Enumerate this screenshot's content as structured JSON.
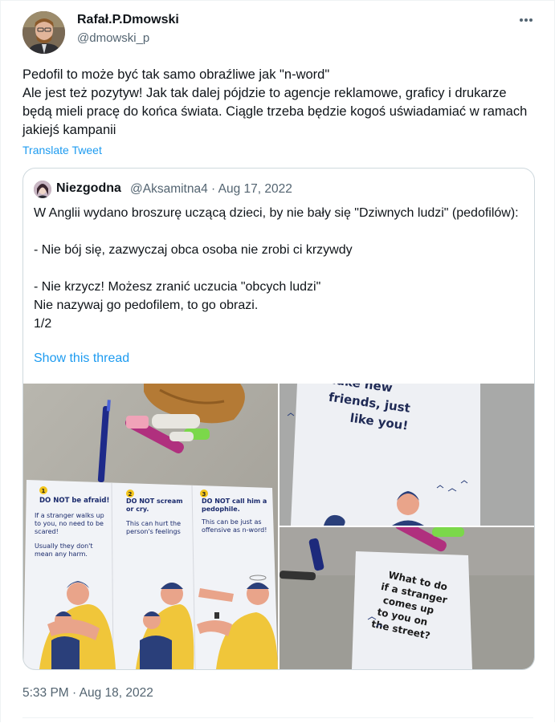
{
  "tweet": {
    "author_name": "Rafał.P.Dmowski",
    "author_handle": "@dmowski_p",
    "text": "Pedofil to może być tak samo obraźliwe jak \"n-word\"\nAle jest też pozytyw! Jak tak dalej pójdzie to agencje reklamowe, graficy i drukarze będą mieli pracę do końca świata. Ciągle trzeba będzie kogoś uświadamiać w ramach jakiejś kampanii",
    "translate_label": "Translate Tweet",
    "timestamp": "5:33 PM · Aug 18, 2022",
    "more_icon": "more-horizontal-icon"
  },
  "quote": {
    "author_name": "Niezgodna",
    "meta": "@Aksamitna4 · Aug 17, 2022",
    "text": "W Anglii wydano broszurę uczącą dzieci, by nie bały się \"Dziwnych ludzi\" (pedofilów):\n\n- Nie bój się, zazwyczaj obca osoba nie zrobi ci krzywdy\n\n- Nie krzycz! Możesz zranić uczucia \"obcych ludzi\"\nNie nazywaj go pedofilem, to go obrazi.\n1/2",
    "show_thread_label": "Show this thread",
    "images": {
      "leaflet": {
        "p1_title": "DO NOT be afraid!",
        "p1_body": "If a stranger walks up to you, no need to be scared!",
        "p1_body2": "Usually they don't mean any harm.",
        "p2_title": "DO NOT scream or cry.",
        "p2_body": "This can hurt the person's feelings",
        "p3_title": "DO NOT call him a pedophile.",
        "p3_body": "This can be just as offensive as n-word!"
      },
      "card_top": {
        "line1": "...ake new",
        "line2": "friends, just",
        "line3": "like you!"
      },
      "card_bottom": {
        "line1": "What to do",
        "line2": "if a stranger",
        "line3": "comes up",
        "line4": "to you on",
        "line5": "the street?"
      }
    }
  }
}
